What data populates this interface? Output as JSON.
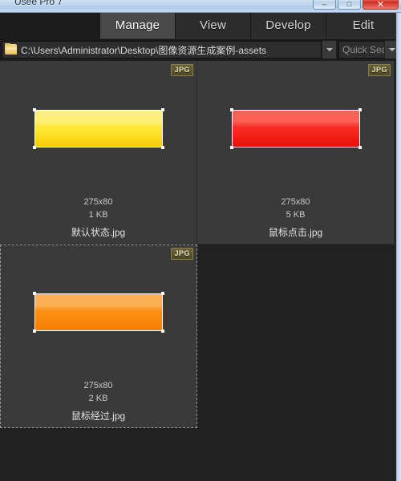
{
  "window": {
    "title": "Usee Pro 7",
    "buttons": [
      {
        "name": "minimize-button",
        "glyph": "–"
      },
      {
        "name": "maximize-button",
        "glyph": "□"
      },
      {
        "name": "close-button",
        "glyph": "✕"
      }
    ]
  },
  "tabs": [
    {
      "label": "Manage",
      "active": true
    },
    {
      "label": "View",
      "active": false
    },
    {
      "label": "Develop",
      "active": false
    },
    {
      "label": "Edit",
      "active": false
    }
  ],
  "pathbar": {
    "folder_icon": "folder-icon",
    "path": "C:\\Users\\Administrator\\Desktop\\图像资源生成案例-assets",
    "path_dropdown_icon": "chevron-down-icon",
    "search_placeholder": "Quick Sea",
    "search_value": "",
    "search_dropdown_icon": "chevron-down-icon"
  },
  "thumbnails": [
    {
      "badge": "JPG",
      "dimensions": "275x80",
      "filesize": "1 KB",
      "filename": "默认状态.jpg",
      "gradient_top": "#fdf07a",
      "gradient_mid": "#ffe733",
      "gradient_bottom": "#f5cc00",
      "selected": false
    },
    {
      "badge": "JPG",
      "dimensions": "275x80",
      "filesize": "5 KB",
      "filename": "鼠标点击.jpg",
      "gradient_top": "#fb6157",
      "gradient_mid": "#f82a20",
      "gradient_bottom": "#ed0d06",
      "selected": false
    },
    {
      "badge": "JPG",
      "dimensions": "275x80",
      "filesize": "2 KB",
      "filename": "鼠标经过.jpg",
      "gradient_top": "#fcb055",
      "gradient_mid": "#f98e12",
      "gradient_bottom": "#f47d05",
      "selected": true
    }
  ],
  "colors": {
    "panel_bg": "#3a3a3a",
    "app_bg": "#212121",
    "toolbar_bg": "#1c1c1c",
    "tab_active_bg": "#4a4a4a",
    "window_border": "#c3d8ee"
  }
}
